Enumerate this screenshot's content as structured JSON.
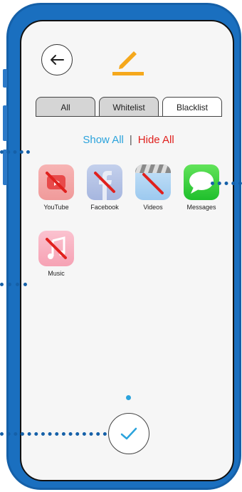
{
  "header": {
    "back_icon": "arrow-left-icon",
    "edit_icon": "pencil-icon",
    "accent": "#f5a81c"
  },
  "tabs": [
    {
      "label": "All",
      "active": false
    },
    {
      "label": "Whitelist",
      "active": false
    },
    {
      "label": "Blacklist",
      "active": true
    }
  ],
  "filter": {
    "show_all": "Show All",
    "separator": "|",
    "hide_all": "Hide All",
    "show_color": "#2ba3dc",
    "hide_color": "#e0211e"
  },
  "apps": [
    {
      "label": "YouTube",
      "icon": "youtube-icon",
      "blocked": true
    },
    {
      "label": "Facebook",
      "icon": "facebook-icon",
      "blocked": true
    },
    {
      "label": "Videos",
      "icon": "videos-icon",
      "blocked": true
    },
    {
      "label": "Messages",
      "icon": "messages-icon",
      "blocked": false
    },
    {
      "label": "Music",
      "icon": "music-icon",
      "blocked": true
    }
  ],
  "footer": {
    "confirm_icon": "checkmark-icon"
  }
}
